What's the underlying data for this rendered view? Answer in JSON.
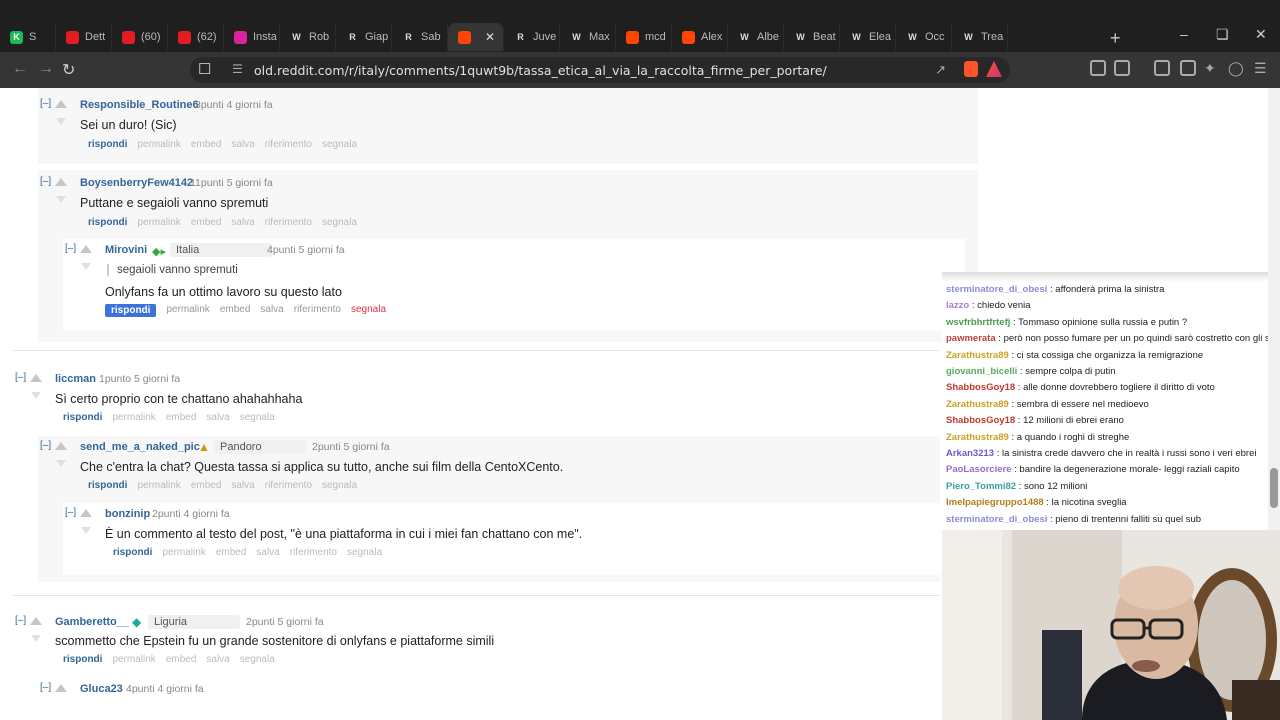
{
  "browser": {
    "tabs": [
      {
        "label": "S",
        "fav": "#1db954",
        "icon": "spotify-icon"
      },
      {
        "label": "Dett",
        "fav": "#e31b23",
        "icon": "youtube-icon"
      },
      {
        "label": "(60)",
        "fav": "#e31b23",
        "icon": "youtube-icon"
      },
      {
        "label": "(62)",
        "fav": "#e31b23",
        "icon": "youtube-icon"
      },
      {
        "label": "Insta",
        "fav": "#d6249f",
        "icon": "instagram-icon"
      },
      {
        "label": "Rob",
        "fav": "#ffffff",
        "icon": "wikipedia-icon"
      },
      {
        "label": "Giap",
        "fav": "#ffffff",
        "icon": "r-icon"
      },
      {
        "label": "Sab",
        "fav": "#ffffff",
        "icon": "r-icon"
      },
      {
        "label": "",
        "fav": "#ff4500",
        "icon": "reddit-icon",
        "active": true
      },
      {
        "label": "Juve",
        "fav": "#ffffff",
        "icon": "r-icon"
      },
      {
        "label": "Max",
        "fav": "#ffffff",
        "icon": "wikipedia-icon"
      },
      {
        "label": "mcd",
        "fav": "#ff4500",
        "icon": "reddit-icon"
      },
      {
        "label": "Alex",
        "fav": "#ff4500",
        "icon": "reddit-icon"
      },
      {
        "label": "Albe",
        "fav": "#ffffff",
        "icon": "wikipedia-icon"
      },
      {
        "label": "Beat",
        "fav": "#ffffff",
        "icon": "wikipedia-icon"
      },
      {
        "label": "Elea",
        "fav": "#ffffff",
        "icon": "wikipedia-icon"
      },
      {
        "label": "Occ",
        "fav": "#ffffff",
        "icon": "wikipedia-icon"
      },
      {
        "label": "Trea",
        "fav": "#ffffff",
        "icon": "wikipedia-icon"
      }
    ],
    "url": "old.reddit.com/r/italy/comments/1quwt9b/tassa_etica_al_via_la_raccolta_firme_per_portare/"
  },
  "actions": {
    "rispondi": "rispondi",
    "permalink": "permalink",
    "embed": "embed",
    "salva": "salva",
    "riferimento": "riferimento",
    "segnala": "segnala",
    "collapse": "[–]"
  },
  "comments": [
    {
      "author": "Responsible_Routine6",
      "meta": "3punti 4 giorni fa",
      "body": "Sei un duro! (Sic)"
    },
    {
      "author": "BoysenberryFew4142",
      "meta": "11punti 5 giorni fa",
      "body": "Puttane e segaioli vanno spremuti"
    },
    {
      "author": "Mirovini",
      "flair": "Italia",
      "meta": "4punti 5 giorni fa",
      "quote": "segaioli vanno spremuti",
      "body": "Onlyfans fa un ottimo lavoro su questo lato"
    },
    {
      "author": "liccman",
      "meta": "1punto 5 giorni fa",
      "body": "Sì certo proprio con te chattano ahahahhaha"
    },
    {
      "author": "send_me_a_naked_pic",
      "flair": "Pandoro",
      "meta": "2punti 5 giorni fa",
      "body": "Che c'entra la chat? Questa tassa si applica su tutto, anche sui film della CentoXCento."
    },
    {
      "author": "bonzinip",
      "meta": "2punti 4 giorni fa",
      "body": "È un commento al testo del post, \"è una piattaforma in cui i miei fan chattano con me\"."
    },
    {
      "author": "Gamberetto__",
      "flair": "Liguria",
      "meta": "2punti 5 giorni fa",
      "body": "scommetto che Epstein fu un grande sostenitore di onlyfans e piattaforme simili"
    },
    {
      "author": "Gluca23",
      "meta": "4punti 4 giorni fa",
      "body": ""
    }
  ],
  "chat": [
    {
      "user": "sterminatore_di_obesi",
      "color": "#8c8cd9",
      "msg": "affonderà prima la sinistra"
    },
    {
      "user": "lazzo",
      "color": "#a880c8",
      "msg": "chiedo venia"
    },
    {
      "user": "wsvfrbhrtfrtefj",
      "color": "#4b9b4b",
      "msg": "Tommaso opinione sulla russia e putin ?"
    },
    {
      "user": "pawmerata",
      "color": "#c04040",
      "msg": "però non posso fumare per un po quindi sarò costretto con gli snus"
    },
    {
      "user": "Zarathustra89",
      "color": "#c9a227",
      "msg": "ci sta cossiga che organizza la remigrazione"
    },
    {
      "user": "giovanni_bicelli",
      "color": "#5aaa5a",
      "msg": "sempre colpa di putin"
    },
    {
      "user": "ShabbosGoy18",
      "color": "#c0392b",
      "msg": "alle donne dovrebbero togliere il diritto di voto"
    },
    {
      "user": "Zarathustra89",
      "color": "#c9a227",
      "msg": "sembra di essere nel medioevo"
    },
    {
      "user": "ShabbosGoy18",
      "color": "#c0392b",
      "msg": "12 milioni di ebrei erano"
    },
    {
      "user": "Zarathustra89",
      "color": "#c9a227",
      "msg": "a quando i roghi di streghe"
    },
    {
      "user": "Arkan3213",
      "color": "#6a5acd",
      "msg": "la sinistra crede davvero che in realtà i russi sono i veri ebrei"
    },
    {
      "user": "PaoLasorciere",
      "color": "#9a6ad0",
      "msg": "bandire la degenerazione morale- leggi raziali capito"
    },
    {
      "user": "Piero_Tommi82",
      "color": "#3aa0a0",
      "msg": "sono 12 milioni"
    },
    {
      "user": "ImeIpapiegruppo1488",
      "color": "#b08020",
      "msg": "la nicotina sveglia"
    },
    {
      "user": "sterminatore_di_obesi",
      "color": "#8c8cd9",
      "msg": "pieno di trentenni falliti su quel sub"
    }
  ]
}
